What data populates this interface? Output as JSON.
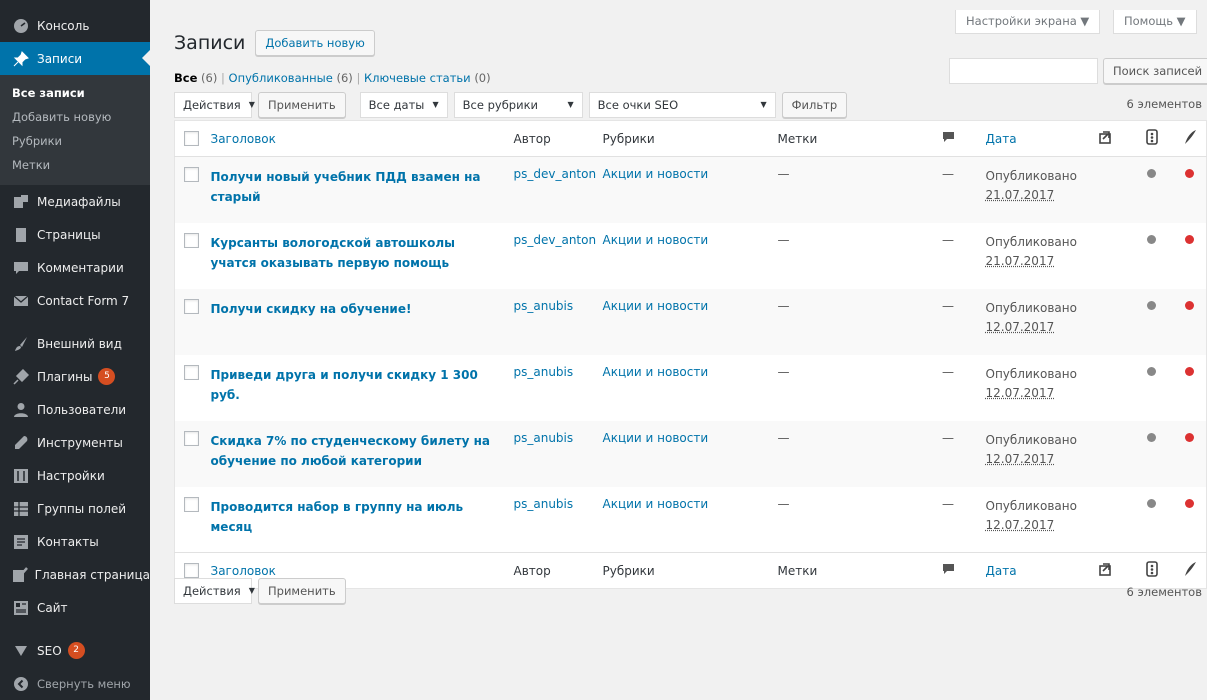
{
  "sidebar": {
    "items": [
      {
        "label": "Консоль",
        "icon": "dashboard-icon"
      },
      {
        "label": "Записи",
        "icon": "pin-icon",
        "current": true
      }
    ],
    "submenu": [
      "Все записи",
      "Добавить новую",
      "Рубрики",
      "Метки"
    ],
    "items2": [
      {
        "label": "Медиафайлы",
        "icon": "media-icon"
      },
      {
        "label": "Страницы",
        "icon": "page-icon"
      },
      {
        "label": "Комментарии",
        "icon": "comment-icon"
      },
      {
        "label": "Contact Form 7",
        "icon": "mail-icon"
      }
    ],
    "items3": [
      {
        "label": "Внешний вид",
        "icon": "brush-icon"
      },
      {
        "label": "Плагины",
        "icon": "plugin-icon",
        "badge": "5"
      },
      {
        "label": "Пользователи",
        "icon": "user-icon"
      },
      {
        "label": "Инструменты",
        "icon": "wrench-icon"
      },
      {
        "label": "Настройки",
        "icon": "settings-icon"
      },
      {
        "label": "Группы полей",
        "icon": "fields-icon"
      },
      {
        "label": "Контакты",
        "icon": "contacts-icon"
      },
      {
        "label": "Главная страница",
        "icon": "edit-icon"
      },
      {
        "label": "Сайт",
        "icon": "site-icon"
      }
    ],
    "seo": {
      "label": "SEO",
      "badge": "2",
      "icon": "seo-icon"
    },
    "collapse": "Свернуть меню"
  },
  "top": {
    "screen_options": "Настройки экрана ▼",
    "help": "Помощь ▼"
  },
  "header": {
    "title": "Записи",
    "add_new": "Добавить новую"
  },
  "views": {
    "all": "Все",
    "all_count": "(6)",
    "published": "Опубликованные",
    "published_count": "(6)",
    "key": "Ключевые статьи",
    "key_count": "(0)"
  },
  "search": {
    "button": "Поиск записей",
    "value": ""
  },
  "tablenav": {
    "actions": "Действия",
    "apply": "Применить",
    "dates": "Все даты",
    "categories": "Все рубрики",
    "seo": "Все очки SEO",
    "filter": "Фильтр",
    "count": "6 элементов"
  },
  "columns": {
    "title": "Заголовок",
    "author": "Автор",
    "categories": "Рубрики",
    "tags": "Метки",
    "date": "Дата"
  },
  "colors": {
    "accent": "#0073aa",
    "sidebar": "#23282d",
    "red_dot": "#dc3232",
    "grey_dot": "#888888"
  },
  "rows": [
    {
      "title": "Получи новый учебник ПДД взамен на старый",
      "author": "ps_dev_anton",
      "category": "Акции и новости",
      "tags": "—",
      "comments": "—",
      "status": "Опубликовано",
      "date": "21.07.2017"
    },
    {
      "title": "Курсанты вологодской автошколы учатся оказывать первую помощь",
      "author": "ps_dev_anton",
      "category": "Акции и новости",
      "tags": "—",
      "comments": "—",
      "status": "Опубликовано",
      "date": "21.07.2017"
    },
    {
      "title": "Получи скидку на обучение!",
      "author": "ps_anubis",
      "category": "Акции и новости",
      "tags": "—",
      "comments": "—",
      "status": "Опубликовано",
      "date": "12.07.2017"
    },
    {
      "title": "Приведи друга и получи скидку 1 300 руб.",
      "author": "ps_anubis",
      "category": "Акции и новости",
      "tags": "—",
      "comments": "—",
      "status": "Опубликовано",
      "date": "12.07.2017"
    },
    {
      "title": "Скидка 7% по студенческому билету на обучение по любой категории",
      "author": "ps_anubis",
      "category": "Акции и новости",
      "tags": "—",
      "comments": "—",
      "status": "Опубликовано",
      "date": "12.07.2017"
    },
    {
      "title": "Проводится набор в группу на июль месяц",
      "author": "ps_anubis",
      "category": "Акции и новости",
      "tags": "—",
      "comments": "—",
      "status": "Опубликовано",
      "date": "12.07.2017"
    }
  ]
}
